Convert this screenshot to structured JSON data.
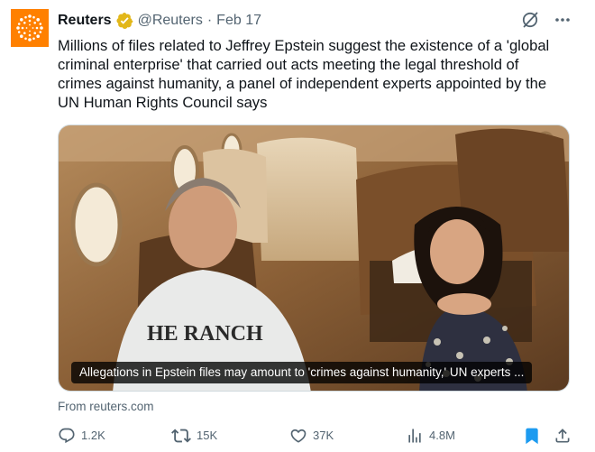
{
  "account": {
    "name": "Reuters",
    "handle": "@Reuters",
    "separator": "·",
    "date": "Feb 17",
    "colors": {
      "avatar_bg": "#ff8000",
      "verified_badge": "#e2b719"
    }
  },
  "tweet": {
    "text": "Millions of files related to Jeffrey Epstein suggest the existence of a 'global criminal enterprise' that carried out acts meeting the legal threshold of crimes against humanity, a panel of independent experts appointed by the UN Human Rights Council says"
  },
  "media": {
    "caption": "Allegations in Epstein files may amount to 'crimes against humanity,' UN experts ...",
    "shirt_text": "HE RANCH"
  },
  "link_source": "From reuters.com",
  "actions": {
    "reply_count": "1.2K",
    "retweet_count": "15K",
    "like_count": "37K",
    "view_count": "4.8M",
    "icons": [
      "reply-icon",
      "retweet-icon",
      "like-icon",
      "views-icon",
      "bookmark-icon",
      "share-icon"
    ],
    "bookmark_color": "#1d9bf0"
  }
}
